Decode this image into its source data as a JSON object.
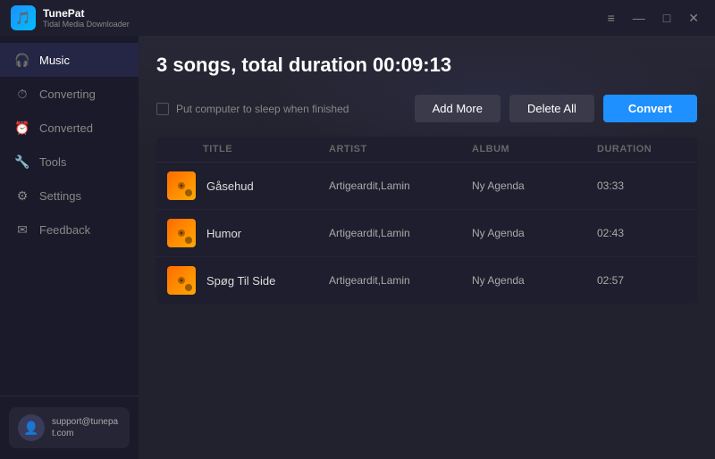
{
  "titleBar": {
    "appName": "TunePat",
    "appSubtitle": "Tidal Media Downloader",
    "controls": [
      "≡",
      "—",
      "□",
      "✕"
    ]
  },
  "sidebar": {
    "items": [
      {
        "id": "music",
        "label": "Music",
        "icon": "🎧",
        "active": true
      },
      {
        "id": "converting",
        "label": "Converting",
        "icon": "⏱",
        "active": false
      },
      {
        "id": "converted",
        "label": "Converted",
        "icon": "⏰",
        "active": false
      },
      {
        "id": "tools",
        "label": "Tools",
        "icon": "🔧",
        "active": false
      },
      {
        "id": "settings",
        "label": "Settings",
        "icon": "⚙",
        "active": false
      },
      {
        "id": "feedback",
        "label": "Feedback",
        "icon": "✉",
        "active": false
      }
    ],
    "user": {
      "email": "support@tunepat.com"
    }
  },
  "content": {
    "pageTitle": "3 songs, total duration 00:09:13",
    "checkbox": {
      "label": "Put computer to sleep when finished"
    },
    "buttons": {
      "addMore": "Add More",
      "deleteAll": "Delete All",
      "convert": "Convert"
    },
    "table": {
      "headers": [
        "",
        "TITLE",
        "ARTIST",
        "ALBUM",
        "DURATION"
      ],
      "rows": [
        {
          "title": "Gåsehud",
          "artist": "Artigeardit,Lamin",
          "album": "Ny Agenda",
          "duration": "03:33"
        },
        {
          "title": "Humor",
          "artist": "Artigeardit,Lamin",
          "album": "Ny Agenda",
          "duration": "02:43"
        },
        {
          "title": "Spøg Til Side",
          "artist": "Artigeardit,Lamin",
          "album": "Ny Agenda",
          "duration": "02:57"
        }
      ]
    }
  }
}
